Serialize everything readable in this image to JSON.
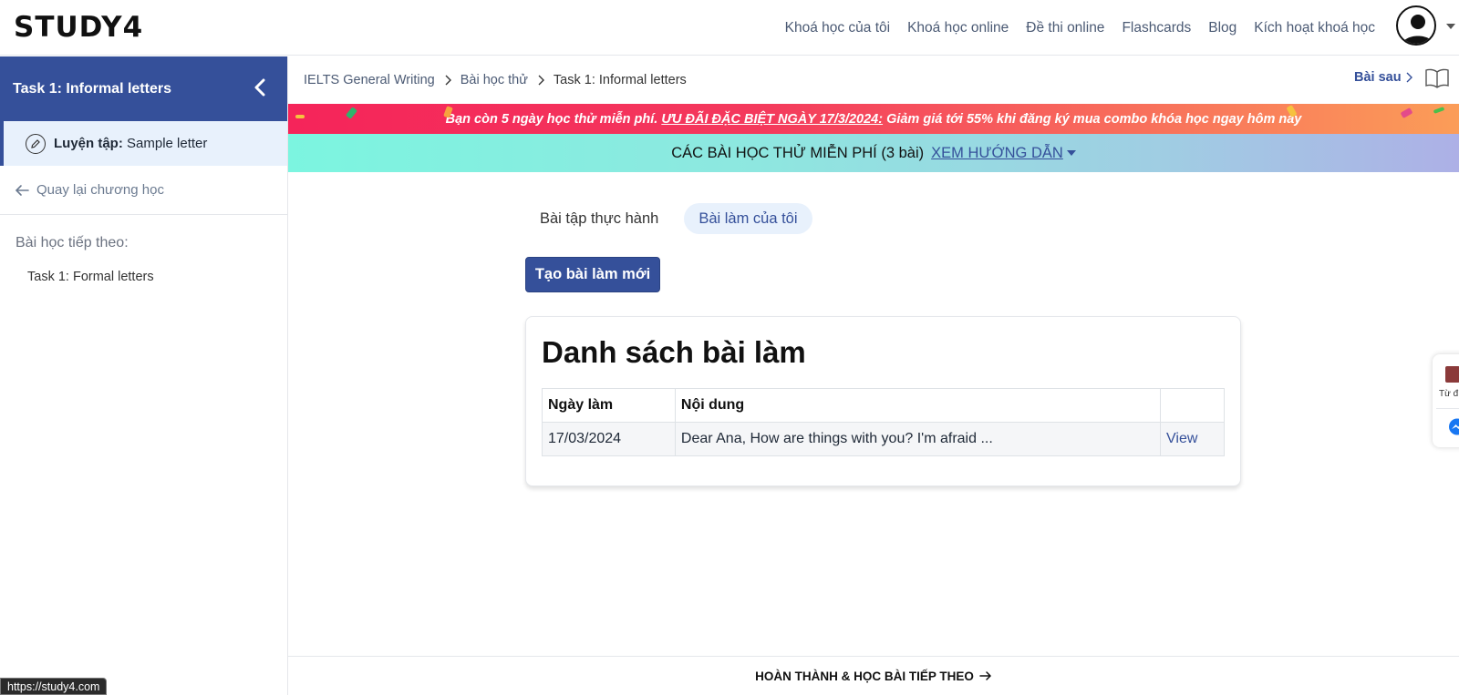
{
  "brand": {
    "logo": "STUDY4"
  },
  "nav": {
    "items": [
      "Khoá học của tôi",
      "Khoá học online",
      "Đề thi online",
      "Flashcards",
      "Blog",
      "Kích hoạt khoá học"
    ]
  },
  "sidebar": {
    "title": "Task 1: Informal letters",
    "current_item": {
      "prefix": "Luyện tập:",
      "label": "Sample letter"
    },
    "back_label": "Quay lại chương học",
    "next_heading": "Bài học tiếp theo:",
    "next_item": "Task 1: Formal letters"
  },
  "breadcrumb": {
    "items": [
      "IELTS General Writing",
      "Bài học thử",
      "Task 1: Informal letters"
    ],
    "next_label": "Bài sau"
  },
  "promo": {
    "before": "Bạn còn 5 ngày học thử miễn phí.",
    "highlight": "ƯU ĐÃI ĐẶC BIỆT NGÀY 17/3/2024:",
    "after": "Giảm giá tới 55% khi đăng ký mua combo khóa học ngay hôm nay"
  },
  "trial": {
    "text": "CÁC BÀI HỌC THỬ MIỄN PHÍ (3 bài)",
    "link": "XEM HƯỚNG DẪN"
  },
  "tabs": [
    {
      "label": "Bài tập thực hành",
      "active": false
    },
    {
      "label": "Bài làm của tôi",
      "active": true
    }
  ],
  "create_button": "Tạo bài làm mới",
  "submissions": {
    "title": "Danh sách bài làm",
    "columns": [
      "Ngày làm",
      "Nội dung",
      ""
    ],
    "rows": [
      {
        "date": "17/03/2024",
        "content": "Dear Ana, How are things with you? I'm afraid ...",
        "action": "View"
      }
    ]
  },
  "footer": {
    "label": "HOÀN THÀNH & HỌC BÀI TIẾP THEO"
  },
  "status_url": "https://study4.com",
  "float_widget": {
    "dict_label": "Từ đ"
  },
  "colors": {
    "primary": "#35509a",
    "active_bg": "#e8f1fc"
  }
}
